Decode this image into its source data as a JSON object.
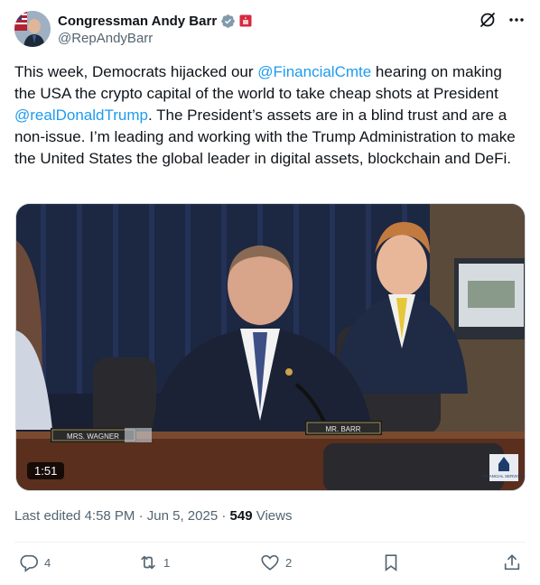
{
  "author": {
    "display_name": "Congressman Andy Barr",
    "handle": "@RepAndyBarr",
    "verified_icon": "verified-badge-icon",
    "affiliation_icon": "government-affiliation-icon"
  },
  "tweet": {
    "text_parts": {
      "p1": "This week, Democrats hijacked our ",
      "m1": "@FinancialCmte",
      "p2": " hearing on making the USA the crypto capital of the world to take cheap shots at President ",
      "m2": "@realDonaldTrump",
      "p3": ". The President’s assets are in a blind trust and are a non-issue. I’m leading and working with the Trump Administration to make the United States the global leader in digital assets, blockchain and DeFi."
    }
  },
  "media": {
    "duration": "1:51",
    "placards": {
      "left": "MRS. WAGNER",
      "center": "MR. BARR"
    },
    "watermark": "FINANCIAL SERVICES"
  },
  "meta": {
    "edited_label": "Last edited",
    "time": "4:58 PM",
    "date": "Jun 5, 2025",
    "views_count": "549",
    "views_label": "Views"
  },
  "actions": {
    "replies": "4",
    "reposts": "1",
    "likes": "2"
  },
  "colors": {
    "link": "#1d9bf0",
    "secondary_text": "#536471",
    "primary_text": "#0f1419"
  }
}
